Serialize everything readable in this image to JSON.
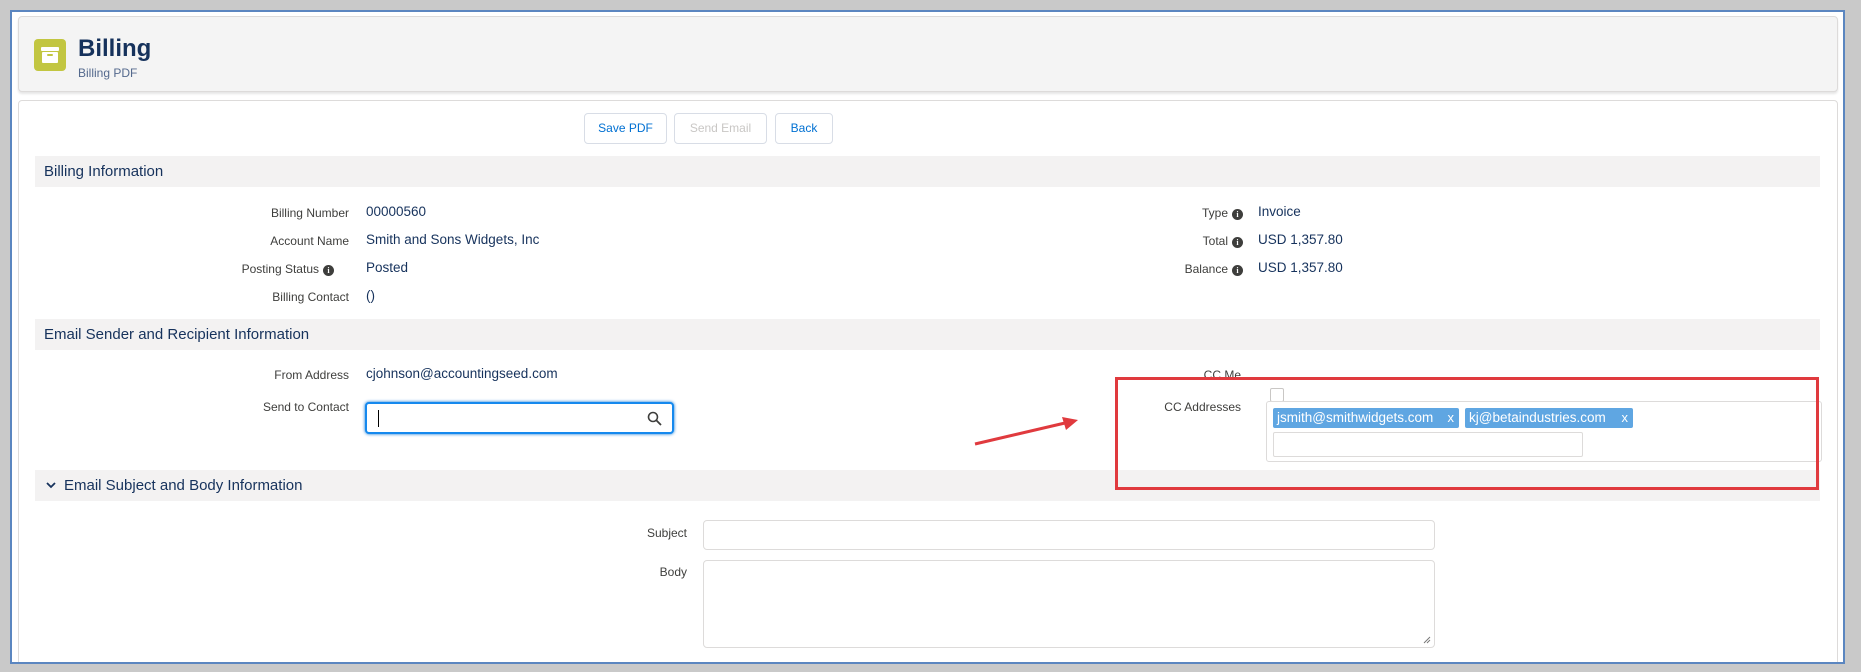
{
  "header": {
    "title": "Billing",
    "subtitle": "Billing PDF"
  },
  "toolbar": {
    "save_pdf": "Save PDF",
    "send_email": "Send Email",
    "back": "Back"
  },
  "billing_info": {
    "section_title": "Billing Information",
    "billing_number_label": "Billing Number",
    "billing_number": "00000560",
    "account_name_label": "Account Name",
    "account_name": "Smith and Sons Widgets, Inc",
    "posting_status_label": "Posting Status",
    "posting_status": "Posted",
    "billing_contact_label": "Billing Contact",
    "billing_contact": "()",
    "type_label": "Type",
    "type": "Invoice",
    "total_label": "Total",
    "total": "USD 1,357.80",
    "balance_label": "Balance",
    "balance": "USD 1,357.80"
  },
  "email_info": {
    "section_title": "Email Sender and Recipient Information",
    "from_address_label": "From Address",
    "from_address": "cjohnson@accountingseed.com",
    "send_to_contact_label": "Send to Contact",
    "send_to_contact_value": "",
    "cc_me_label": "CC Me",
    "cc_addresses_label": "CC Addresses",
    "cc_addresses": [
      "jsmith@smithwidgets.com",
      "kj@betaindustries.com"
    ],
    "pill_remove": "x"
  },
  "email_body": {
    "section_title": "Email Subject and Body Information",
    "subject_label": "Subject",
    "subject_value": "",
    "body_label": "Body",
    "body_value": ""
  },
  "colors": {
    "brand_icon": "#c2c641",
    "pill": "#5fa6e2",
    "annotation": "#e03a3e",
    "focus": "#1589ee"
  },
  "icons": {
    "header": "archive-icon",
    "info": "info-icon",
    "search": "search-icon",
    "chevron": "chevron-down-icon",
    "annotation": "arrow-annotation"
  }
}
